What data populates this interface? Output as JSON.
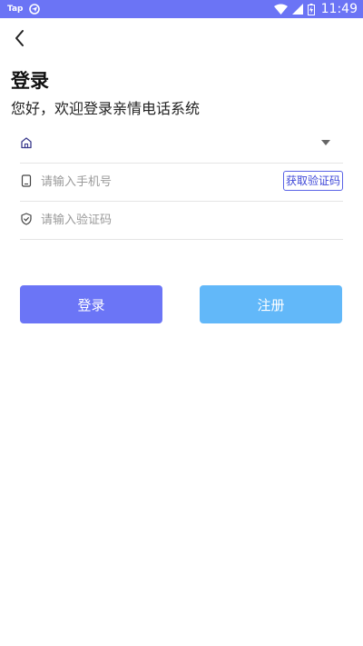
{
  "status_bar": {
    "app_label": "Tap",
    "time": "11:49",
    "bar_color": "#6b74f5",
    "icons": [
      "location-icon",
      "wifi-icon",
      "signal-icon",
      "battery-icon"
    ]
  },
  "header": {
    "back_icon": "chevron-left-icon",
    "title": "登录",
    "subtitle": "您好，欢迎登录亲情电话系统"
  },
  "form": {
    "dropdown": {
      "icon": "home-icon",
      "value": ""
    },
    "phone": {
      "icon": "phone-icon",
      "placeholder": "请输入手机号",
      "value": "",
      "get_code_label": "获取验证码"
    },
    "code": {
      "icon": "shield-icon",
      "placeholder": "请输入验证码",
      "value": ""
    }
  },
  "buttons": {
    "login_label": "登录",
    "login_color": "#6b75f6",
    "register_label": "注册",
    "register_color": "#62b8f9"
  }
}
